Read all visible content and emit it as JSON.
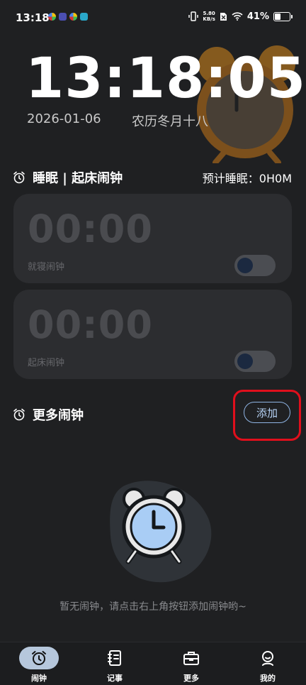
{
  "status_bar": {
    "time": "13:18",
    "net_speed_value": "5.80",
    "net_speed_unit": "KB/s",
    "battery": "41%"
  },
  "clock": {
    "time": "13:18:05",
    "date": "2026-01-06",
    "lunar": "农历冬月十八"
  },
  "sleep_section": {
    "title": "睡眠 | 起床闹钟",
    "estimate": "预计睡眠：0H0M",
    "cards": [
      {
        "time": "00:00",
        "label": "就寝闹钟",
        "enabled": false
      },
      {
        "time": "00:00",
        "label": "起床闹钟",
        "enabled": false
      }
    ]
  },
  "more_section": {
    "title": "更多闹钟",
    "add_label": "添加",
    "empty_text": "暂无闹钟，请点击右上角按钮添加闹钟哟~"
  },
  "tabs": [
    {
      "label": "闹钟",
      "icon": "alarm-clock-icon",
      "active": true
    },
    {
      "label": "记事",
      "icon": "notebook-icon",
      "active": false
    },
    {
      "label": "更多",
      "icon": "toolbox-icon",
      "active": false
    },
    {
      "label": "我的",
      "icon": "profile-icon",
      "active": false
    }
  ],
  "colors": {
    "background": "#1f2022",
    "card": "#2c2d30",
    "accent": "#8fb4e3",
    "highlight": "#e00f1c",
    "tab_active": "#b6c7dc"
  }
}
